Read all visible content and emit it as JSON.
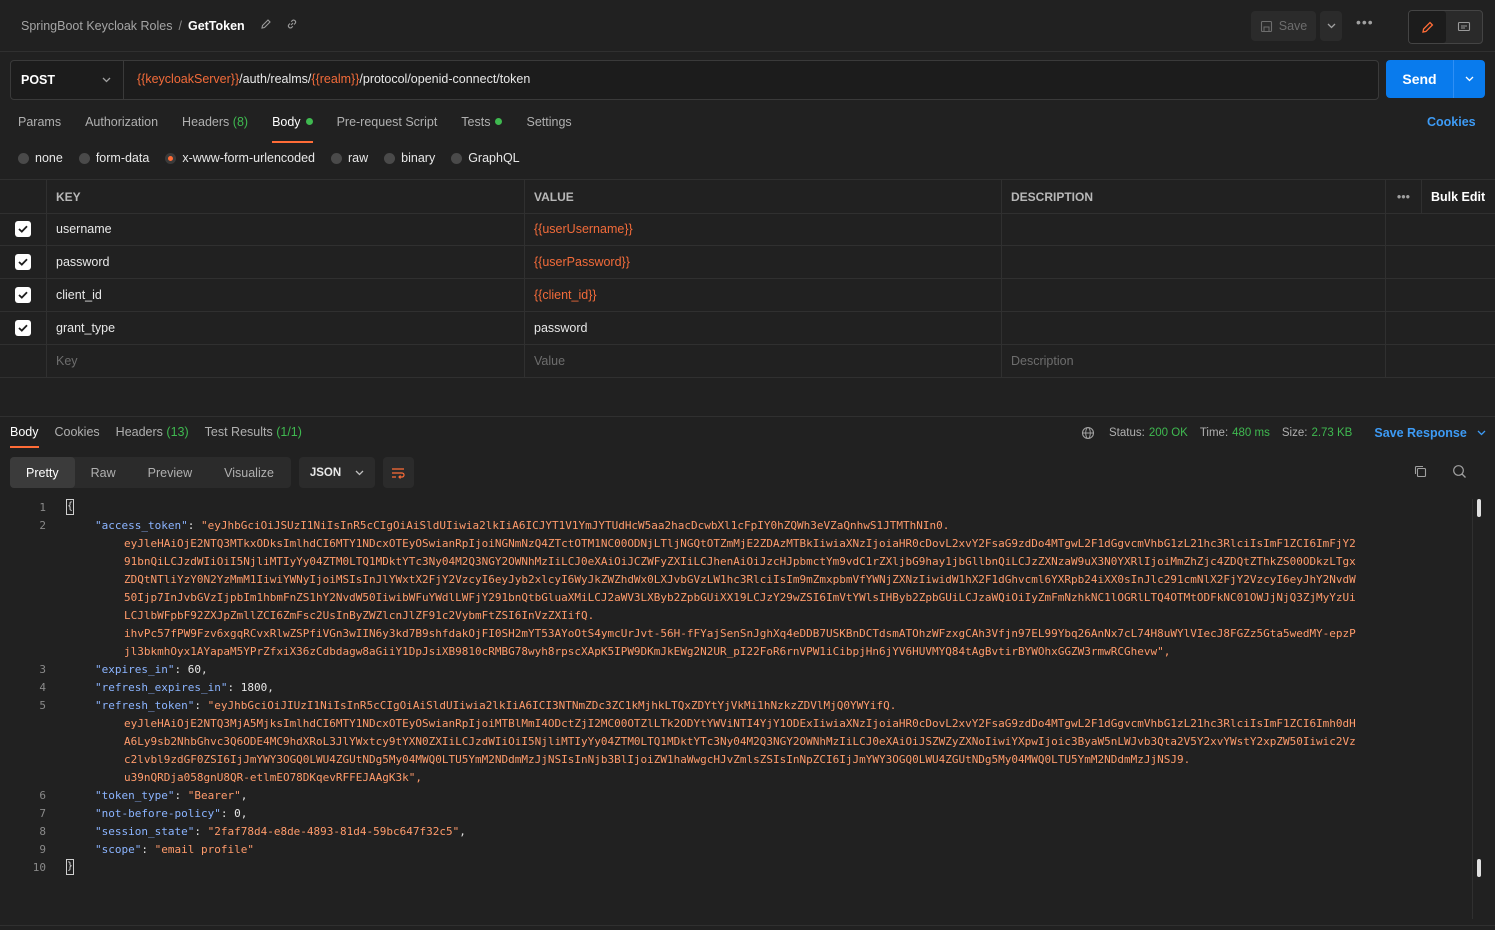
{
  "header": {
    "collection": "SpringBoot Keycloak Roles",
    "separator": "/",
    "request_name": "GetToken",
    "save_label": "Save",
    "more": "•••"
  },
  "request": {
    "method": "POST",
    "url_parts": [
      "{{keycloakServer}}",
      "/auth/realms/",
      "{{realm}}",
      "/protocol/openid-connect/token"
    ],
    "send_label": "Send"
  },
  "tabs": [
    {
      "label": "Params"
    },
    {
      "label": "Authorization"
    },
    {
      "label": "Headers",
      "count": "(8)"
    },
    {
      "label": "Body",
      "dot": true
    },
    {
      "label": "Pre-request Script"
    },
    {
      "label": "Tests",
      "dot": true
    },
    {
      "label": "Settings"
    }
  ],
  "cookies_label": "Cookies",
  "body_types": [
    "none",
    "form-data",
    "x-www-form-urlencoded",
    "raw",
    "binary",
    "GraphQL"
  ],
  "params_table": {
    "headers": {
      "key": "KEY",
      "value": "VALUE",
      "description": "DESCRIPTION",
      "more": "•••",
      "bulk": "Bulk Edit"
    },
    "rows": [
      {
        "key": "username",
        "value": "{{userUsername}}"
      },
      {
        "key": "password",
        "value": "{{userPassword}}"
      },
      {
        "key": "client_id",
        "value": "{{client_id}}"
      },
      {
        "key": "grant_type",
        "value": "password"
      }
    ],
    "placeholder": {
      "key": "Key",
      "value": "Value",
      "description": "Description"
    }
  },
  "response": {
    "tabs": [
      "Body",
      "Cookies",
      "Headers",
      "Test Results"
    ],
    "headers_count": "(13)",
    "test_count": "(1/1)",
    "status_label": "Status:",
    "status_value": "200 OK",
    "time_label": "Time:",
    "time_value": "480 ms",
    "size_label": "Size:",
    "size_value": "2.73 KB",
    "save_response": "Save Response",
    "views": [
      "Pretty",
      "Raw",
      "Preview",
      "Visualize"
    ],
    "format": "JSON"
  },
  "code": {
    "line_numbers": [
      "1",
      "2",
      "3",
      "4",
      "5",
      "6",
      "7",
      "8",
      "9",
      "10"
    ],
    "access_token_key": "\"access_token\"",
    "access_token_lines": [
      "\"eyJhbGciOiJSUzI1NiIsInR5cCIgOiAiSldUIiwia2lkIiA6ICJYT1V1YmJYTUdHcW5aa2hacDcwbXl1cFpIY0hZQWh3eVZaQnhwS1JTMThNIn0.",
      "eyJleHAiOjE2NTQ3MTkxODksImlhdCI6MTY1NDcxOTEyOSwianRpIjoiNGNmNzQ4ZTctOTM1NC00ODNjLTljNGQtOTZmMjE2ZDAzMTBkIiwiaXNzIjoiaHR0cDovL2xvY2FsaG9zdDo4MTgwL2F1dGgvcmVhbG1zL21hc3RlciIsImF1ZCI6ImFjY2",
      "91bnQiLCJzdWIiOiI5NjliMTIyYy04ZTM0LTQ1MDktYTc3Ny04M2Q3NGY2OWNhMzIiLCJ0eXAiOiJCZWFyZXIiLCJhenAiOiJzcHJpbmctYm9vdC1rZXljbG9hay1jbGllbnQiLCJzZXNzaW9uX3N0YXRlIjoiMmZhZjc4ZDQtZThkZS00ODkzLTgx",
      "ZDQtNTliYzY0N2YzMmM1IiwiYWNyIjoiMSIsInJlYWxtX2FjY2VzcyI6eyJyb2xlcyI6WyJkZWZhdWx0LXJvbGVzLW1hc3RlciIsIm9mZmxpbmVfYWNjZXNzIiwidW1hX2F1dGhvcml6YXRpb24iXX0sInJlc291cmNlX2FjY2VzcyI6eyJhY2NvdW",
      "50Ijp7InJvbGVzIjpbIm1hbmFnZS1hY2NvdW50IiwibWFuYWdlLWFjY291bnQtbGluaXMiLCJ2aWV3LXByb2ZpbGUiXX19LCJzY29wZSI6ImVtYWlsIHByb2ZpbGUiLCJzaWQiOiIyZmFmNzhkNC1lOGRlLTQ4OTMtODFkNC01OWJjNjQ3ZjMyYzUi",
      "LCJlbWFpbF92ZXJpZmllZCI6ZmFsc2UsInByZWZlcnJlZF91c2VybmFtZSI6InVzZXIifQ.",
      "ihvPc57fPW9Fzv6xgqRCvxRlwZSPfiVGn3wIIN6y3kd7B9shfdakOjFI0SH2mYT53AYoOtS4ymcUrJvt-56H-fFYajSenSnJghXq4eDDB7USKBnDCTdsmATOhzWFzxgCAh3Vfjn97EL99Ybq26AnNx7cL74H8uWYlVIecJ8FGZz5Gta5wedMY-epzP",
      "jl3bkmhOyx1AYapaM5YPrZfxiX36zCdbdagw8aGiiY1DpJsiXB9810cRMBG78wyh8rpscXApK5IPW9DKmJkEWg2N2UR_pI22FoR6rnVPW1iCibpjHn6jYV6HUVMYQ84tAgBvtirBYWOhxGGZW3rmwRCGhevw\","
    ],
    "expires_key": "\"expires_in\"",
    "expires_val": "60",
    "refresh_expires_key": "\"refresh_expires_in\"",
    "refresh_expires_val": "1800",
    "refresh_token_key": "\"refresh_token\"",
    "refresh_token_lines": [
      "\"eyJhbGciOiJIUzI1NiIsInR5cCIgOiAiSldUIiwia2lkIiA6ICI3NTNmZDc3ZC1kMjhkLTQxZDYtYjVkMi1hNzkzZDVlMjQ0YWYifQ.",
      "eyJleHAiOjE2NTQ3MjA5MjksImlhdCI6MTY1NDcxOTEyOSwianRpIjoiMTBlMmI4ODctZjI2MC00OTZlLTk2ODYtYWViNTI4YjY1ODExIiwiaXNzIjoiaHR0cDovL2xvY2FsaG9zdDo4MTgwL2F1dGgvcmVhbG1zL21hc3RlciIsImF1ZCI6Imh0dH",
      "A6Ly9sb2NhbGhvc3Q6ODE4MC9hdXRoL3JlYWxtcy9tYXN0ZXIiLCJzdWIiOiI5NjliMTIyYy04ZTM0LTQ1MDktYTc3Ny04M2Q3NGY2OWNhMzIiLCJ0eXAiOiJSZWZyZXNoIiwiYXpwIjoic3ByaW5nLWJvb3Qta2V5Y2xvYWstY2xpZW50Iiwic2Vz",
      "c2lvbl9zdGF0ZSI6IjJmYWY3OGQ0LWU4ZGUtNDg5My04MWQ0LTU5YmM2NDdmMzJjNSIsInNjb3BlIjoiZW1haWwgcHJvZmlsZSIsInNpZCI6IjJmYWY3OGQ0LWU4ZGUtNDg5My04MWQ0LTU5YmM2NDdmMzJjNSJ9.",
      "u39nQRDja058gnU8QR-etlmEO78DKqevRFFEJAAgK3k\","
    ],
    "token_type_key": "\"token_type\"",
    "token_type_val": "\"Bearer\"",
    "nbp_key": "\"not-before-policy\"",
    "nbp_val": "0",
    "session_key": "\"session_state\"",
    "session_val": "\"2faf78d4-e8de-4893-81d4-59bc647f32c5\"",
    "scope_key": "\"scope\"",
    "scope_val": "\"email profile\""
  },
  "colors": {
    "accent": "#ff6c37",
    "send": "#097bed",
    "link": "#3d9bf5",
    "ok": "#3fb950"
  }
}
